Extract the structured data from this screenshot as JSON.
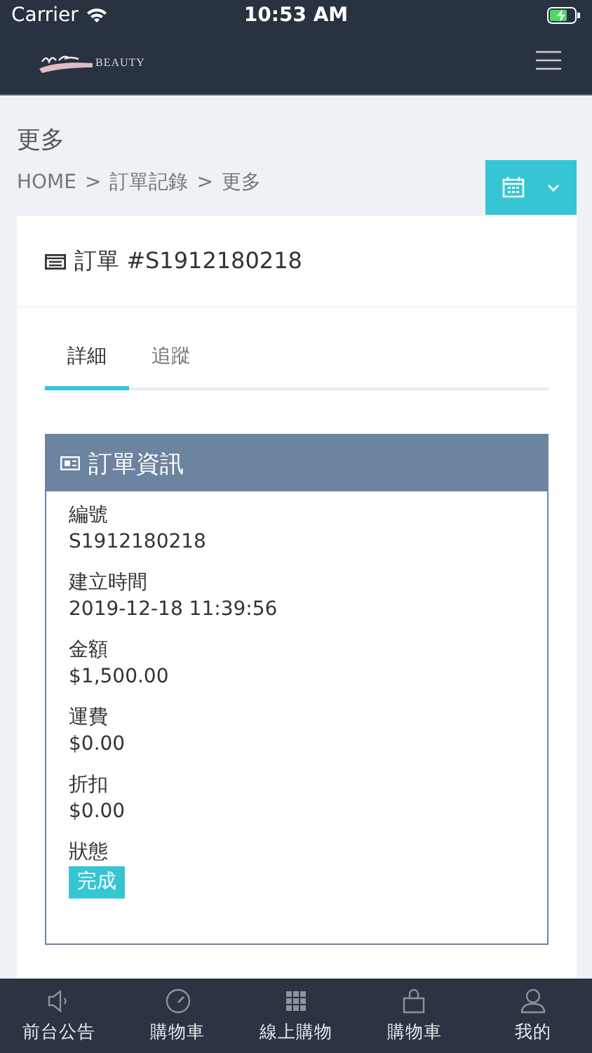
{
  "status_bar": {
    "carrier": "Carrier",
    "time": "10:53 AM"
  },
  "nav": {
    "logo_text": "BEAUTY"
  },
  "page": {
    "title": "更多",
    "breadcrumb": [
      "HOME",
      "訂單記錄",
      "更多"
    ],
    "separator": ">"
  },
  "order": {
    "title": "訂單 #S1912180218",
    "tabs": [
      {
        "label": "詳細",
        "selected": true
      },
      {
        "label": "追蹤",
        "selected": false
      }
    ],
    "panel_title": "訂單資訊",
    "fields": [
      {
        "label": "編號",
        "value": "S1912180218",
        "kind": "text"
      },
      {
        "label": "建立時間",
        "value": "2019-12-18 11:39:56",
        "kind": "text"
      },
      {
        "label": "金額",
        "value": "$1,500.00",
        "kind": "text"
      },
      {
        "label": "運費",
        "value": "$0.00",
        "kind": "text"
      },
      {
        "label": "折扣",
        "value": "$0.00",
        "kind": "text"
      },
      {
        "label": "狀態",
        "value": "完成",
        "kind": "badge"
      }
    ]
  },
  "tab_bar": [
    {
      "label": "前台公告",
      "kind": "speaker"
    },
    {
      "label": "購物車",
      "kind": "gauge"
    },
    {
      "label": "線上購物",
      "kind": "grid"
    },
    {
      "label": "購物車",
      "kind": "bag"
    },
    {
      "label": "我的",
      "kind": "person"
    }
  ]
}
